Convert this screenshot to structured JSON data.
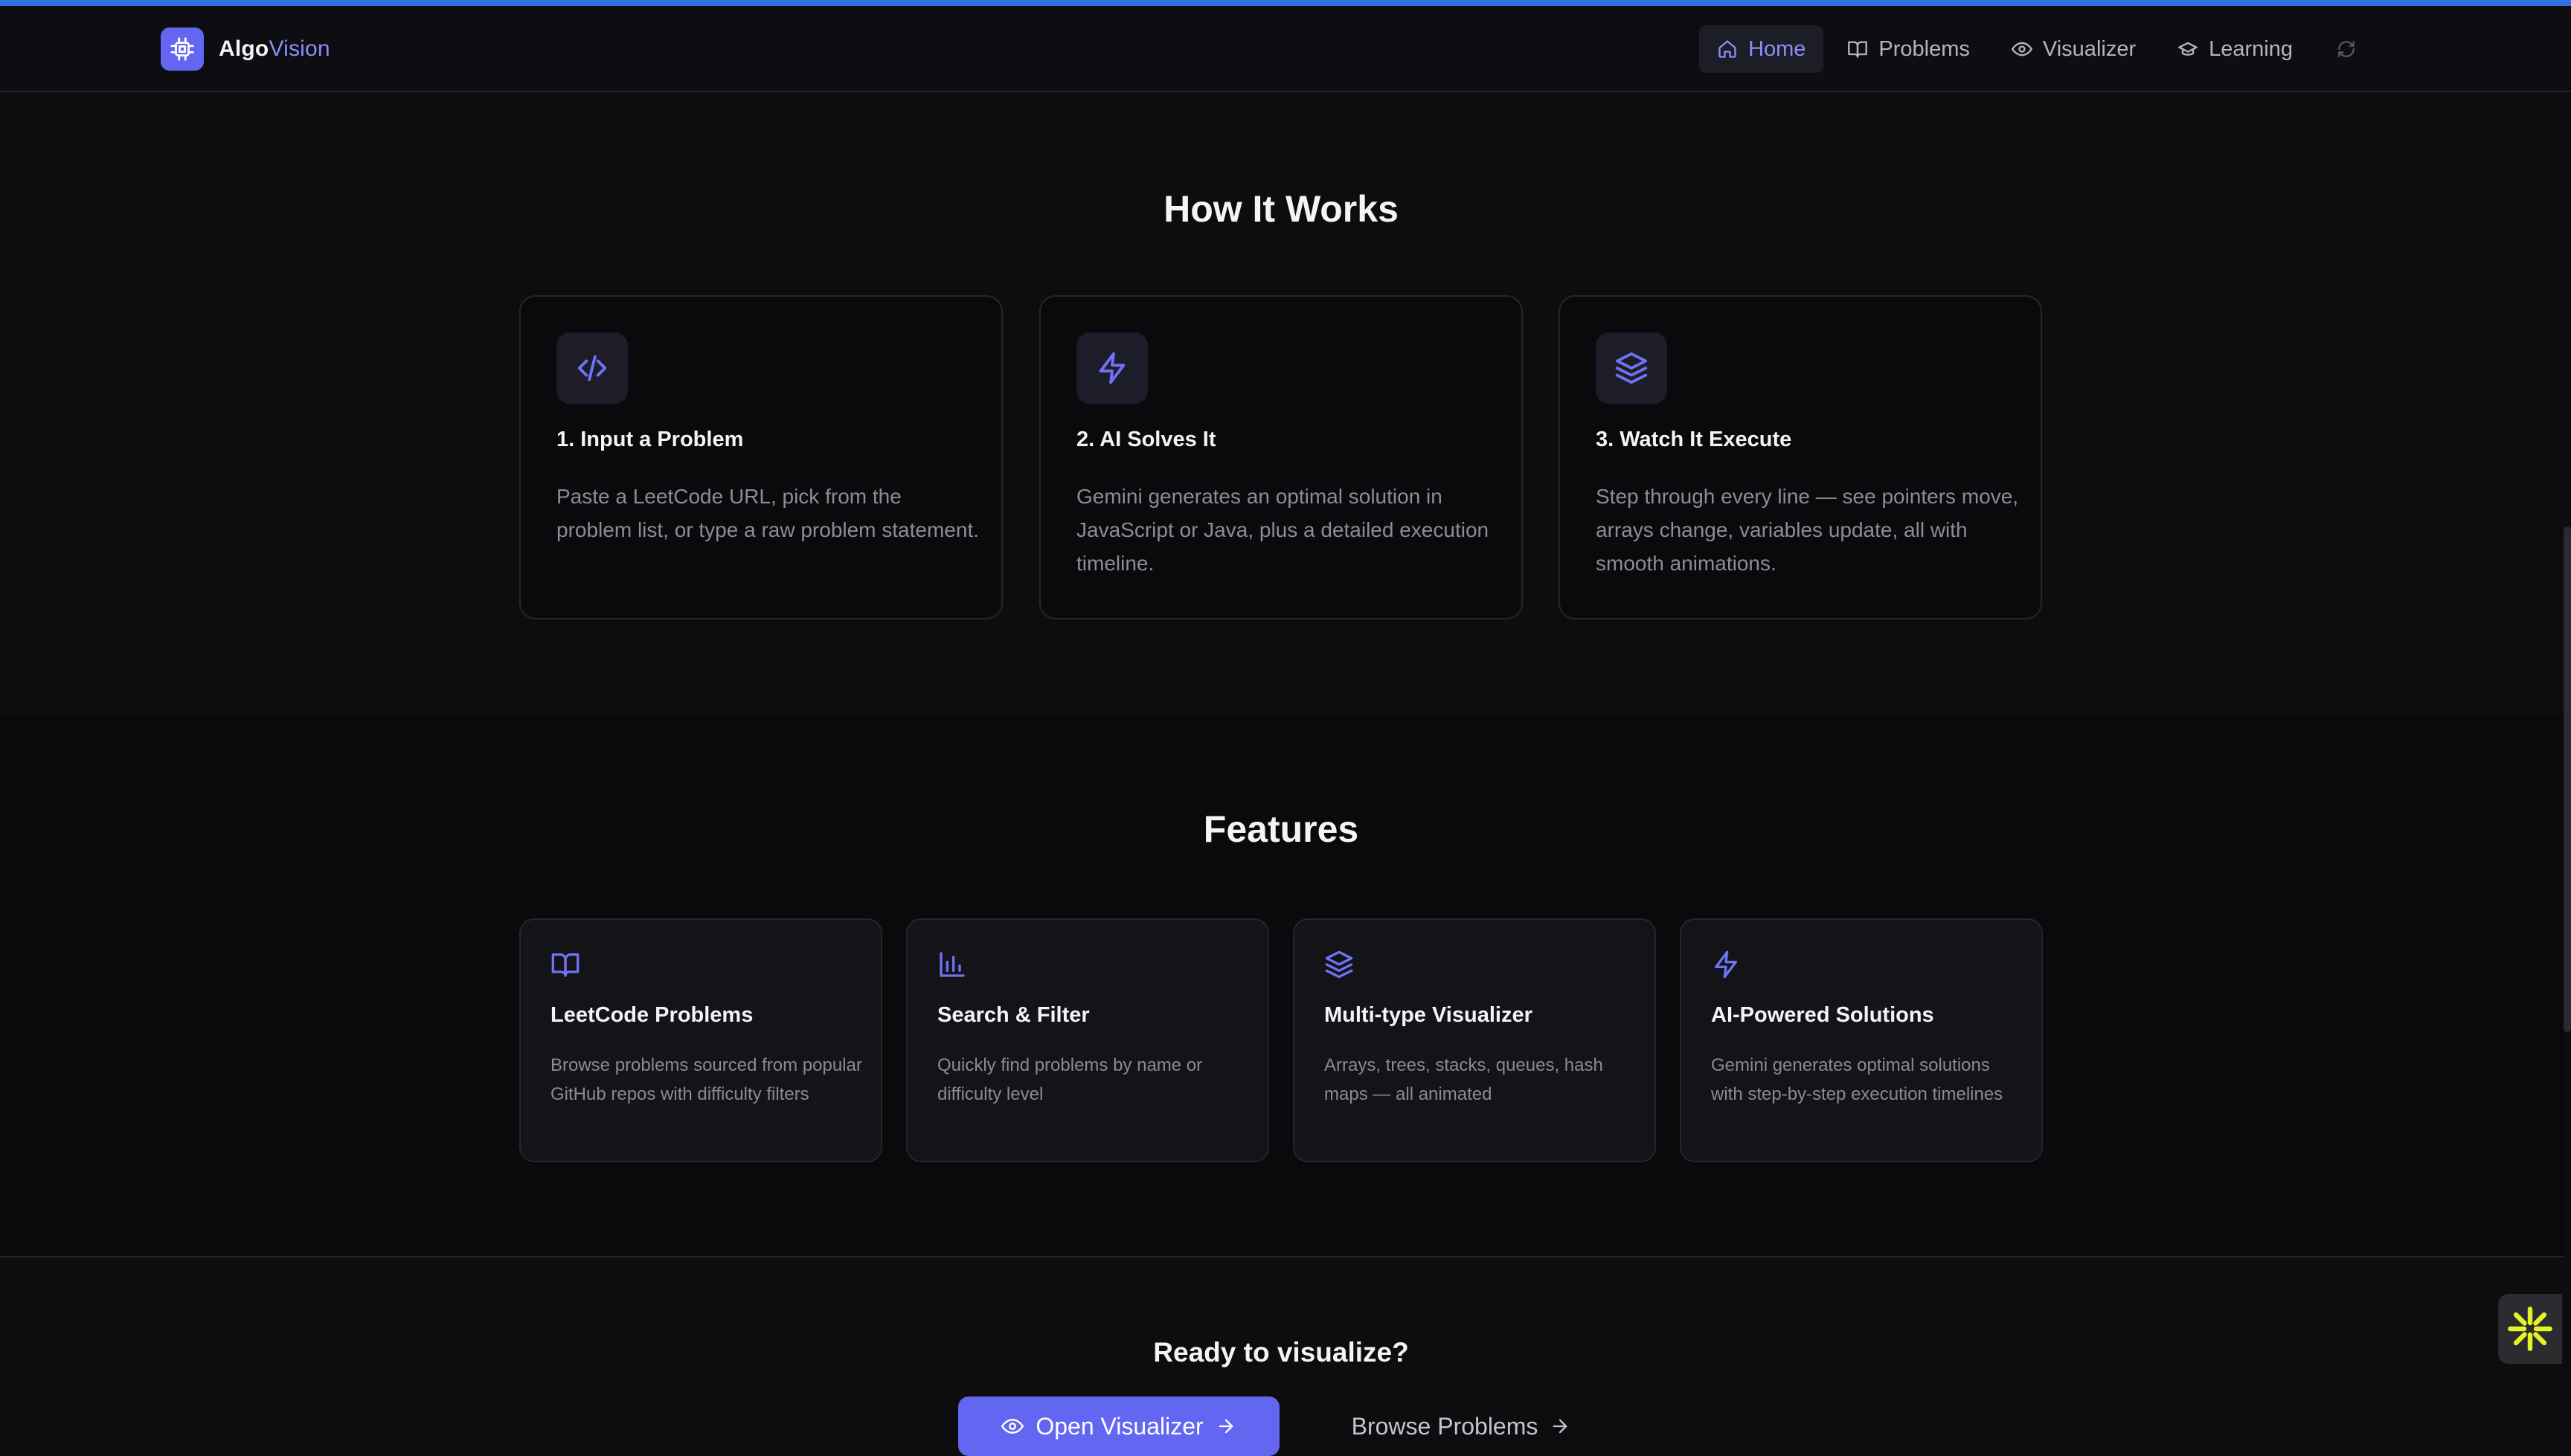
{
  "brand": {
    "name_part1": "Algo",
    "name_part2": "Vision",
    "logo_icon": "cpu-chip-icon"
  },
  "nav": {
    "items": [
      {
        "label": "Home",
        "icon": "home-icon",
        "active": true
      },
      {
        "label": "Problems",
        "icon": "book-open-icon",
        "active": false
      },
      {
        "label": "Visualizer",
        "icon": "eye-icon",
        "active": false
      },
      {
        "label": "Learning",
        "icon": "graduation-cap-icon",
        "active": false
      }
    ],
    "refresh_icon": "refresh-icon"
  },
  "how_it_works": {
    "title": "How It Works",
    "steps": [
      {
        "icon": "code-icon",
        "title": "1. Input a Problem",
        "description": "Paste a LeetCode URL, pick from the problem list, or type a raw problem statement."
      },
      {
        "icon": "lightning-icon",
        "title": "2. AI Solves It",
        "description": "Gemini generates an optimal solution in JavaScript or Java, plus a detailed execution timeline."
      },
      {
        "icon": "layers-icon",
        "title": "3. Watch It Execute",
        "description": "Step through every line — see pointers move, arrays change, variables update, all with smooth animations."
      }
    ]
  },
  "features": {
    "title": "Features",
    "items": [
      {
        "icon": "book-open-icon",
        "title": "LeetCode Problems",
        "description": "Browse problems sourced from popular GitHub repos with difficulty filters"
      },
      {
        "icon": "bar-chart-icon",
        "title": "Search & Filter",
        "description": "Quickly find problems by name or difficulty level"
      },
      {
        "icon": "layers-icon",
        "title": "Multi-type Visualizer",
        "description": "Arrays, trees, stacks, queues, hash maps — all animated"
      },
      {
        "icon": "lightning-icon",
        "title": "AI-Powered Solutions",
        "description": "Gemini generates optimal solutions with step-by-step execution timelines"
      }
    ]
  },
  "cta": {
    "title": "Ready to visualize?",
    "primary_label": "Open Visualizer",
    "secondary_label": "Browse Problems"
  },
  "colors": {
    "accent": "#6366f1",
    "accent_text": "#8b8ef7",
    "top_bar": "#2f6fe0",
    "assistant_star": "#e5f227"
  }
}
